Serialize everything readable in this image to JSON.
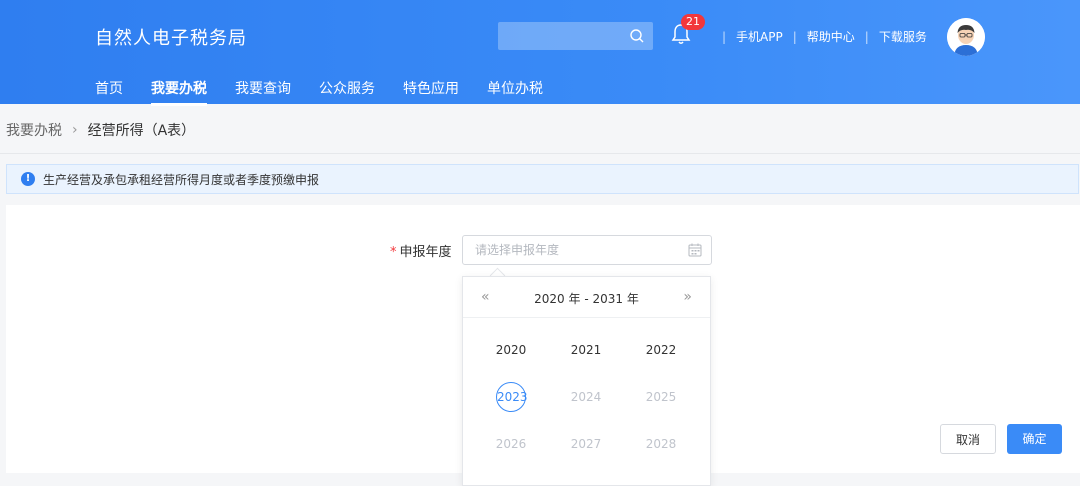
{
  "header": {
    "brand": "自然人电子税务局",
    "search_placeholder": "",
    "notification_count": "21",
    "links": [
      "手机APP",
      "帮助中心",
      "下载服务"
    ],
    "nav": [
      {
        "label": "首页",
        "active": false
      },
      {
        "label": "我要办税",
        "active": true
      },
      {
        "label": "我要查询",
        "active": false
      },
      {
        "label": "公众服务",
        "active": false
      },
      {
        "label": "特色应用",
        "active": false
      },
      {
        "label": "单位办税",
        "active": false
      }
    ]
  },
  "breadcrumb": {
    "root": "我要办税",
    "current": "经营所得（A表）"
  },
  "notice": {
    "text": "生产经营及承包承租经营所得月度或者季度预缴申报"
  },
  "form": {
    "required_mark": "*",
    "year_label": "申报年度",
    "year_placeholder": "请选择申报年度"
  },
  "picker": {
    "range": "2020 年 - 2031 年",
    "prev": "«",
    "next": "»",
    "years": [
      {
        "label": "2020",
        "state": "enabled"
      },
      {
        "label": "2021",
        "state": "enabled"
      },
      {
        "label": "2022",
        "state": "enabled"
      },
      {
        "label": "2023",
        "state": "current"
      },
      {
        "label": "2024",
        "state": "disabled"
      },
      {
        "label": "2025",
        "state": "disabled"
      },
      {
        "label": "2026",
        "state": "disabled"
      },
      {
        "label": "2027",
        "state": "disabled"
      },
      {
        "label": "2028",
        "state": "disabled"
      }
    ]
  },
  "buttons": {
    "cancel": "取消",
    "ok": "确定"
  },
  "colors": {
    "primary": "#3a8bf7",
    "badge": "#f2373b"
  }
}
